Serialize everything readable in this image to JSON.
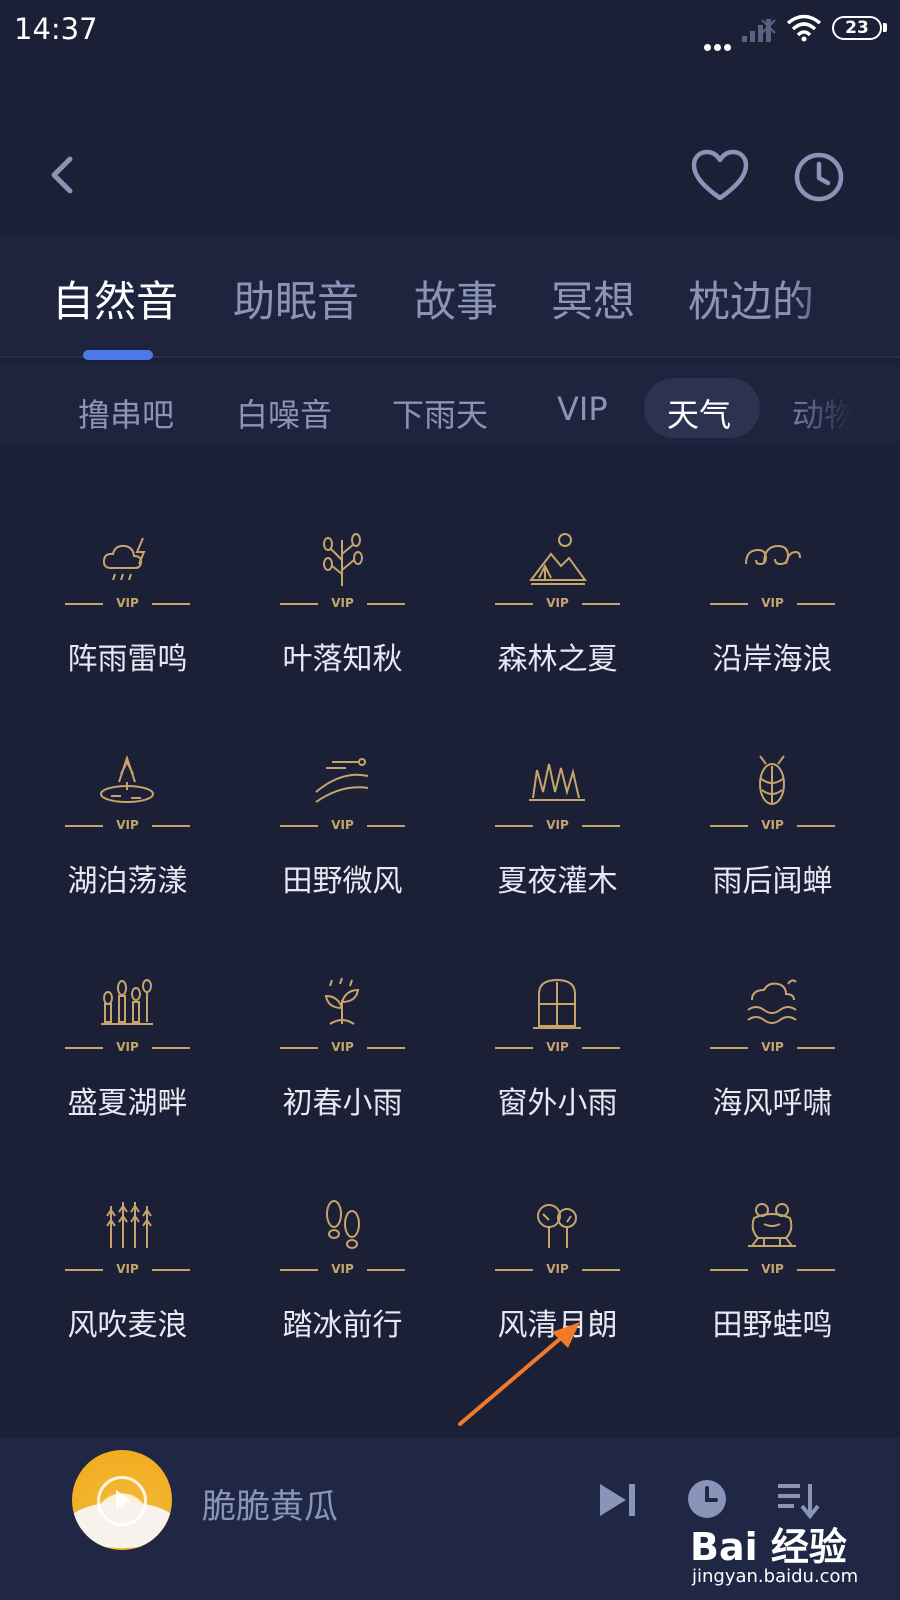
{
  "status_bar": {
    "time": "14:37",
    "battery": "23"
  },
  "header": {
    "back_icon": "chevron-left-icon",
    "favorite_icon": "heart-icon",
    "history_icon": "clock-icon"
  },
  "primary_tabs": [
    {
      "label": "自然音",
      "active": true
    },
    {
      "label": "助眠音",
      "active": false
    },
    {
      "label": "故事",
      "active": false
    },
    {
      "label": "冥想",
      "active": false
    },
    {
      "label": "枕边的",
      "active": false
    }
  ],
  "sub_tabs": [
    {
      "label": "撸串吧",
      "active": false
    },
    {
      "label": "白噪音",
      "active": false
    },
    {
      "label": "下雨天",
      "active": false
    },
    {
      "label": "VIP",
      "active": false
    },
    {
      "label": "天气",
      "active": true
    },
    {
      "label": "动物",
      "active": false
    }
  ],
  "sounds": [
    {
      "label": "阵雨雷鸣",
      "icon": "thunderstorm-icon",
      "badge": "VIP"
    },
    {
      "label": "叶落知秋",
      "icon": "autumn-tree-icon",
      "badge": "VIP"
    },
    {
      "label": "森林之夏",
      "icon": "forest-camp-icon",
      "badge": "VIP"
    },
    {
      "label": "沿岸海浪",
      "icon": "waves-icon",
      "badge": "VIP"
    },
    {
      "label": "湖泊荡漾",
      "icon": "lake-island-icon",
      "badge": "VIP"
    },
    {
      "label": "田野微风",
      "icon": "field-breeze-icon",
      "badge": "VIP"
    },
    {
      "label": "夏夜灌木",
      "icon": "grass-icon",
      "badge": "VIP"
    },
    {
      "label": "雨后闻蝉",
      "icon": "cicada-icon",
      "badge": "VIP"
    },
    {
      "label": "盛夏湖畔",
      "icon": "lakeside-plants-icon",
      "badge": "VIP"
    },
    {
      "label": "初春小雨",
      "icon": "sprout-icon",
      "badge": "VIP"
    },
    {
      "label": "窗外小雨",
      "icon": "window-icon",
      "badge": "VIP"
    },
    {
      "label": "海风呼啸",
      "icon": "sea-wind-icon",
      "badge": "VIP"
    },
    {
      "label": "风吹麦浪",
      "icon": "wheat-icon",
      "badge": "VIP"
    },
    {
      "label": "踏冰前行",
      "icon": "footprints-icon",
      "badge": "VIP"
    },
    {
      "label": "风清月朗",
      "icon": "trees-icon",
      "badge": "VIP"
    },
    {
      "label": "田野蛙鸣",
      "icon": "frog-icon",
      "badge": "VIP"
    }
  ],
  "player": {
    "title": "脆脆黄瓜",
    "next_icon": "skip-next-icon",
    "timer_icon": "timer-icon",
    "playlist_icon": "playlist-icon"
  },
  "watermark": {
    "brand": "Bai 经验",
    "url": "jingyan.baidu.com"
  },
  "colors": {
    "background": "#1b2036",
    "accent": "#4c78ea",
    "gold": "#c7a46b",
    "muted_text": "#8a93b8"
  }
}
